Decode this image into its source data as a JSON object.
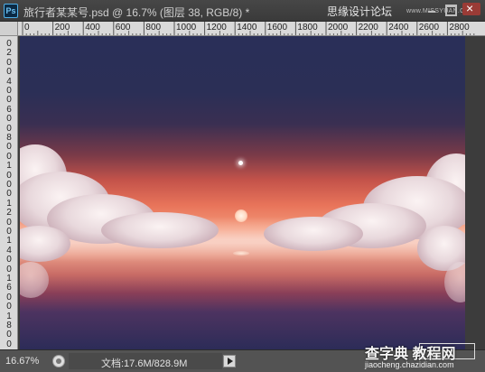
{
  "window": {
    "app_icon_label": "Ps",
    "document_title": "旅行者某某号.psd @ 16.7% (图层 38, RGB/8) *",
    "watermark_text": "思缘设计论坛",
    "watermark_url": "www.MISSYUAN.COM"
  },
  "rulers": {
    "top_ticks": [
      "0",
      "200",
      "400",
      "600",
      "800",
      "1000",
      "1200",
      "1400",
      "1600",
      "1800",
      "2000",
      "2200",
      "2400",
      "2600",
      "2800"
    ],
    "left_ticks": [
      "0",
      "2",
      "0",
      "0",
      "4",
      "0",
      "0",
      "6",
      "0",
      "0",
      "8",
      "0",
      "0",
      "1",
      "0",
      "0",
      "0",
      "1",
      "2",
      "0",
      "0",
      "1",
      "4",
      "0",
      "0",
      "1",
      "6",
      "0",
      "0",
      "1",
      "8",
      "0",
      "0"
    ]
  },
  "canvas": {
    "description_colors": {
      "sky_top": "#2a2f58",
      "glow": "#f49a7a",
      "water_bottom": "#2c2c58"
    }
  },
  "status": {
    "zoom": "16.67%",
    "doc_size": "文档:17.6M/828.9M"
  },
  "site_watermark": {
    "cn": "查字典 教程网",
    "url": "jiaocheng.chazidian.com"
  }
}
